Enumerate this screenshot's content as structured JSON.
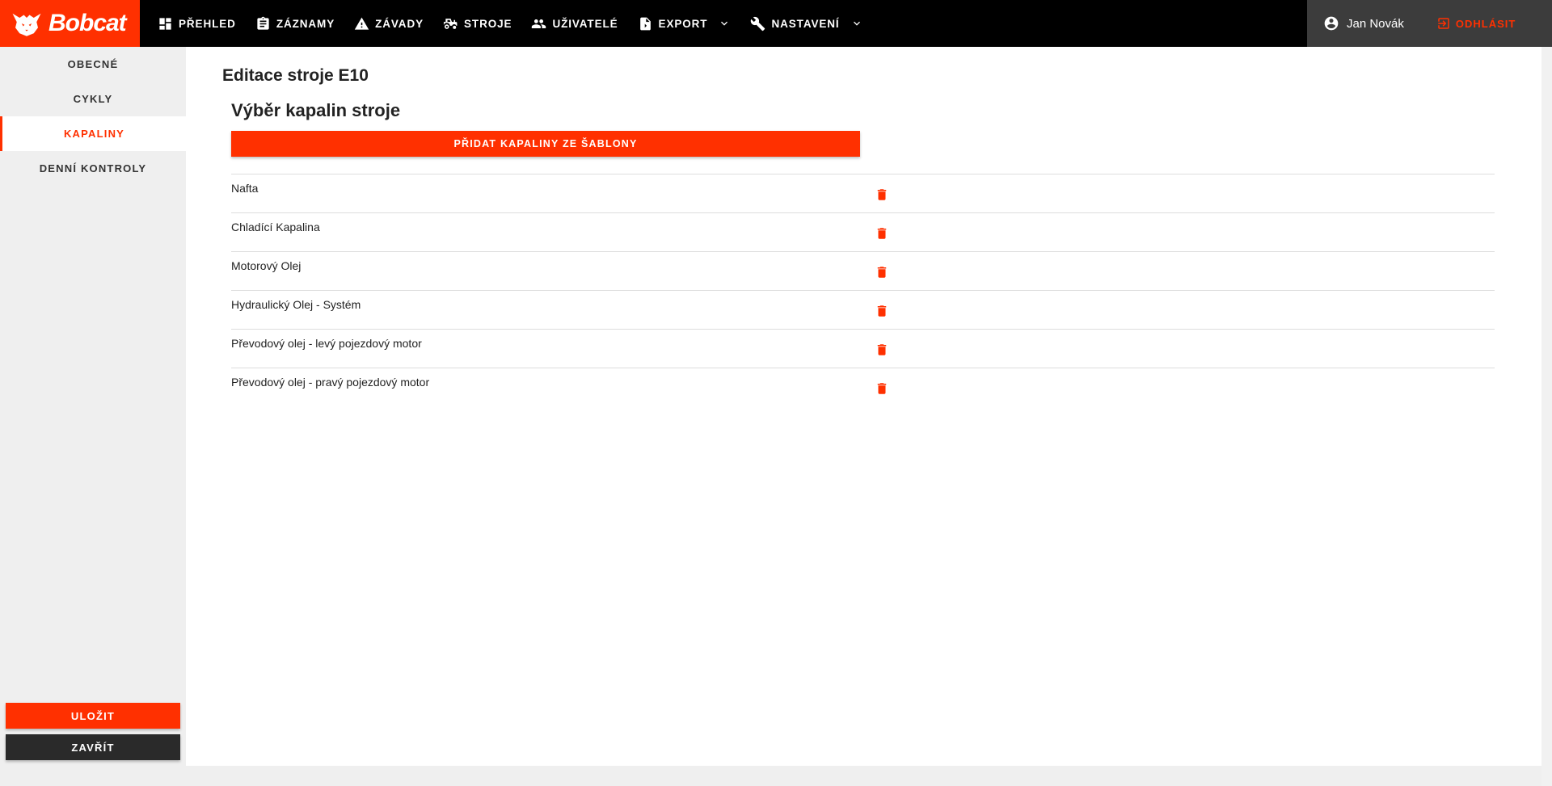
{
  "brand": {
    "name": "Bobcat",
    "color": "#ff3000",
    "icon": "bobcat-logo-icon"
  },
  "nav": [
    {
      "label": "PŘEHLED",
      "icon": "dashboard-icon"
    },
    {
      "label": "ZÁZNAMY",
      "icon": "clipboard-icon"
    },
    {
      "label": "ZÁVADY",
      "icon": "warning-icon"
    },
    {
      "label": "STROJE",
      "icon": "tractor-icon"
    },
    {
      "label": "UŽIVATELÉ",
      "icon": "users-icon"
    },
    {
      "label": "EXPORT",
      "icon": "file-export-icon",
      "dropdown": true
    },
    {
      "label": "NASTAVENÍ",
      "icon": "wrench-icon",
      "dropdown": true
    }
  ],
  "user": {
    "name": "Jan Novák",
    "icon": "account-circle-icon"
  },
  "logout": {
    "label": "ODHLÁSIT",
    "icon": "logout-icon"
  },
  "sidebar": {
    "items": [
      {
        "label": "OBECNÉ",
        "active": false
      },
      {
        "label": "CYKLY",
        "active": false
      },
      {
        "label": "KAPALINY",
        "active": true
      },
      {
        "label": "DENNÍ KONTROLY",
        "active": false
      }
    ],
    "save_label": "ULOŽIT",
    "close_label": "ZAVŘÍT"
  },
  "main": {
    "page_title": "Editace stroje E10",
    "section_title": "Výběr kapalin stroje",
    "add_button_label": "PŘIDAT KAPALINY ZE ŠABLONY",
    "fluids": [
      {
        "name": "Nafta"
      },
      {
        "name": "Chladící Kapalina"
      },
      {
        "name": "Motorový Olej"
      },
      {
        "name": "Hydraulický Olej - Systém"
      },
      {
        "name": "Převodový olej - levý pojezdový motor"
      },
      {
        "name": "Převodový olej - pravý pojezdový motor"
      }
    ],
    "delete_icon": "trash-icon"
  }
}
